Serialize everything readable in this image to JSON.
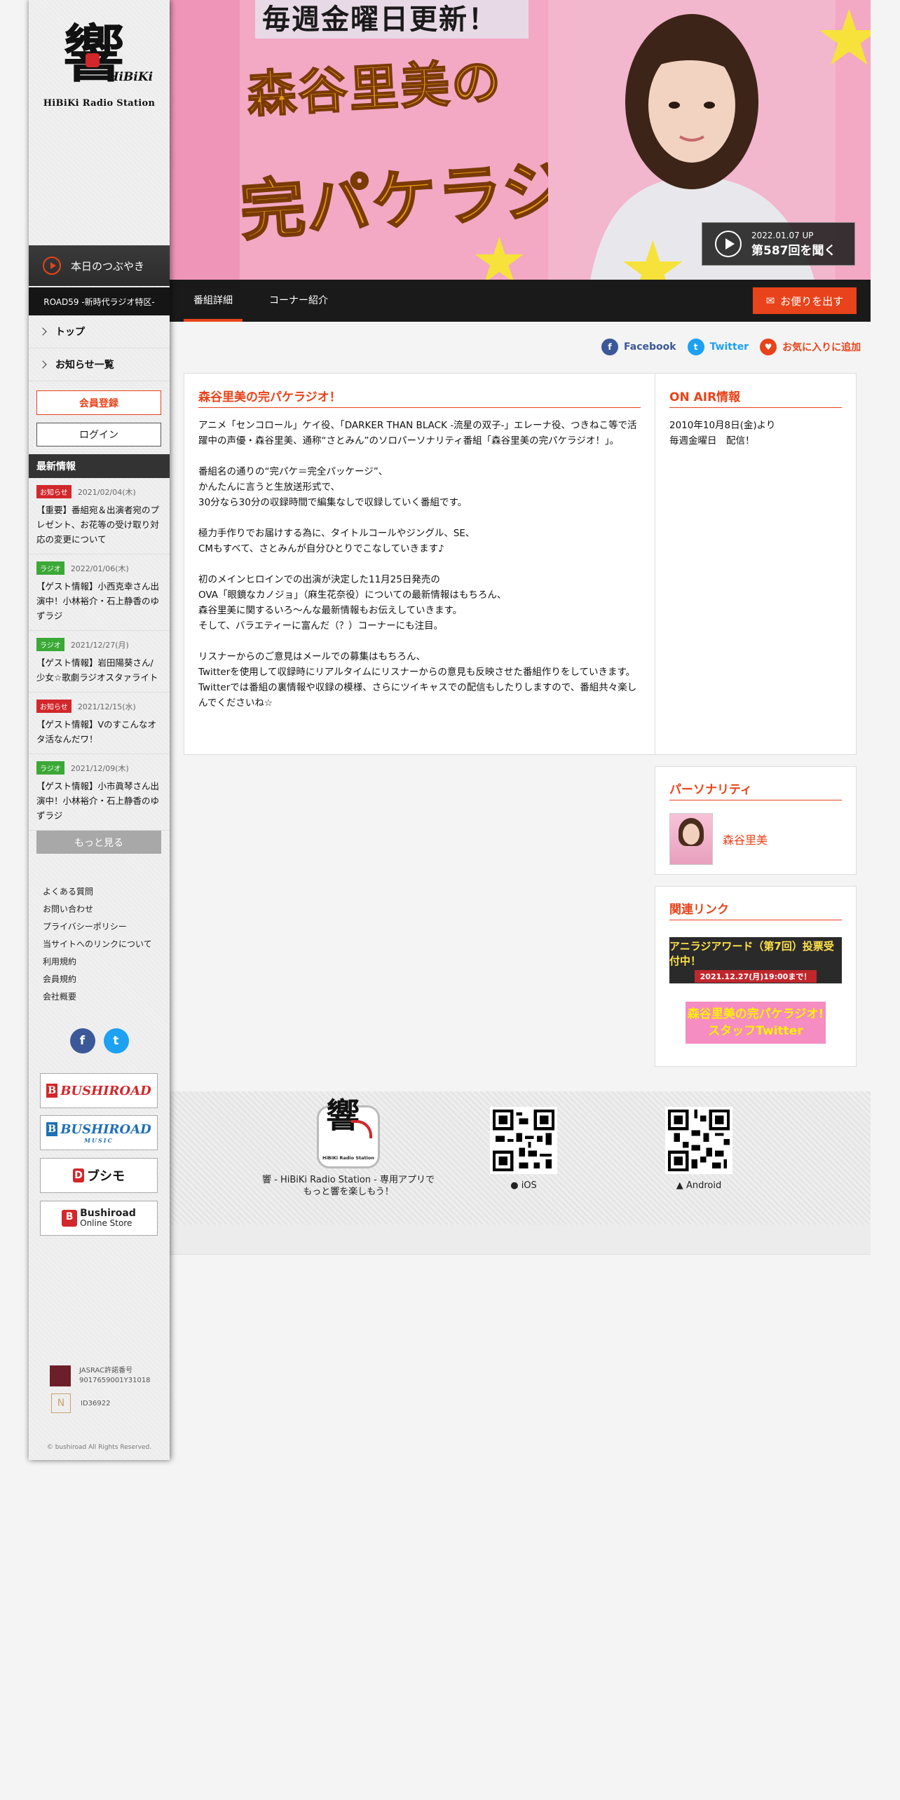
{
  "logo": {
    "kanji": "響",
    "roman": "HiBiKi",
    "name": "HiBiKi Radio Station"
  },
  "sidebar": {
    "tweet_label": "本日のつぶやき",
    "road59": "ROAD59 -新時代ラジオ特区-",
    "nav": [
      "トップ",
      "お知らせ一覧"
    ],
    "member_label": "会員登録",
    "login_label": "ログイン",
    "news_heading": "最新情報",
    "news": [
      {
        "badge": "お知らせ",
        "type": "news",
        "date": "2021/02/04(木)",
        "text": "【重要】番組宛＆出演者宛のプレゼント、お花等の受け取り対応の変更について"
      },
      {
        "badge": "ラジオ",
        "type": "radio",
        "date": "2022/01/06(木)",
        "text": "【ゲスト情報】小西克幸さん出演中！小林裕介・石上静香のゆずラジ"
      },
      {
        "badge": "ラジオ",
        "type": "radio",
        "date": "2021/12/27(月)",
        "text": "【ゲスト情報】岩田陽葵さん/少女☆歌劇ラジオスタァライト"
      },
      {
        "badge": "お知らせ",
        "type": "news",
        "date": "2021/12/15(水)",
        "text": "【ゲスト情報】Vのすこんなオタ活なんだワ！"
      },
      {
        "badge": "ラジオ",
        "type": "radio",
        "date": "2021/12/09(木)",
        "text": "【ゲスト情報】小市眞琴さん出演中！小林裕介・石上静香のゆずラジ"
      }
    ],
    "more_label": "もっと見る",
    "footer_links": [
      "よくある質問",
      "お問い合わせ",
      "プライバシーポリシー",
      "当サイトへのリンクについて",
      "利用規約",
      "会員規約",
      "会社概要"
    ],
    "banners": [
      "BUSHIROAD",
      "BUSHIROAD",
      "ブシモ",
      "Bushiroad"
    ],
    "banner_sub": [
      "",
      "MUSIC",
      "",
      "Online Store"
    ],
    "jasrac_label": "JASRAC許諾番号",
    "jasrac_no": "9017659001Y31018",
    "nextone_no": "ID36922",
    "copyright": "© bushiroad All Rights Reserved."
  },
  "hero": {
    "top_text": "毎週金曜日更新！",
    "big1": "森谷里美の",
    "big2": "完パケラジオ！",
    "up_date": "2022.01.07 UP",
    "up_episode": "第587回を聞く"
  },
  "tabs": [
    "番組詳細",
    "コーナー紹介"
  ],
  "letter_label": "お便りを出す",
  "share": {
    "facebook": "Facebook",
    "twitter": "Twitter",
    "favorite": "お気に入りに追加"
  },
  "program": {
    "title": "森谷里美の完パケラジオ！",
    "description": "アニメ「センコロール」ケイ役、「DARKER THAN BLACK -流星の双子-」エレーナ役、つきねこ等で活躍中の声優・森谷里美、通称“さとみん”のソロパーソナリティ番組「森谷里美の完パケラジオ！」。\n\n番組名の通りの“完パケ＝完全パッケージ”、\nかんたんに言うと生放送形式で、\n30分なら30分の収録時間で編集なしで収録していく番組です。\n\n極力手作りでお届けする為に、タイトルコールやジングル、SE、\nCMもすべて、さとみんが自分ひとりでこなしていきます♪\n\n初のメインヒロインでの出演が決定した11月25日発売の\nOVA「眼鏡なカノジョ」（麻生花奈役）についての最新情報はもちろん、\n森谷里美に関するいろ～んな最新情報もお伝えしていきます。\nそして、バラエティーに富んだ（？）コーナーにも注目。\n\nリスナーからのご意見はメールでの募集はもちろん、\nTwitterを使用して収録時にリアルタイムにリスナーからの意見も反映させた番組作りをしていきます。\nTwitterでは番組の裏情報や収録の模様、さらにツイキャスでの配信もしたりしますので、番組共々楽しんでくださいね☆"
  },
  "onair": {
    "title": "ON AIR情報",
    "text": "2010年10月8日(金)より\n毎週金曜日　配信！"
  },
  "personality": {
    "title": "パーソナリティ",
    "name": "森谷里美"
  },
  "links": {
    "title": "関連リンク",
    "banner1_top": "アニラジアワード（第7回）投票受付中！",
    "banner1_bottom": "2021.12.27(月)19:00まで！",
    "banner2_line1": "森谷里美の完パケラジオ!",
    "banner2_line2": "スタッフTwitter"
  },
  "app": {
    "caption": "響 - HiBiKi Radio Station - 専用アプリで\nもっと響を楽しもう！",
    "icon_label": "HiBiKi Radio Station",
    "ios": "iOS",
    "android": "Android"
  },
  "colors": {
    "accent": "#e8431a",
    "facebook": "#3b5998",
    "twitter": "#1da1f2",
    "news_badge": "#d2272b",
    "radio_badge": "#3aa935"
  },
  "icons": {
    "play": "play-icon",
    "facebook": "facebook-icon",
    "twitter": "twitter-icon",
    "favorite": "heart-icon",
    "letter": "envelope-icon",
    "apple": "apple-icon",
    "android": "android-icon"
  }
}
